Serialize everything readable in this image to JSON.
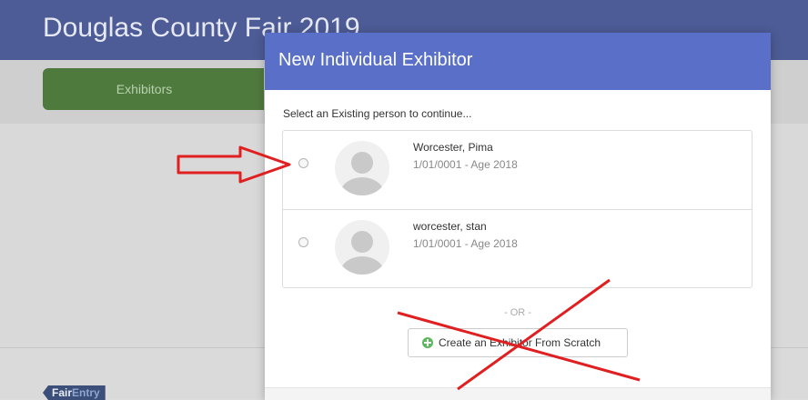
{
  "background": {
    "title": "Douglas County Fair 2019",
    "tab_label": "Exhibitors",
    "logo": "FairEntry"
  },
  "modal": {
    "title": "New Individual Exhibitor",
    "subtitle": "Select an Existing person to continue...",
    "people": [
      {
        "name": "Worcester, Pima",
        "meta": "1/01/0001 - Age 2018"
      },
      {
        "name": "worcester, stan",
        "meta": "1/01/0001 - Age 2018"
      }
    ],
    "or_text": "- OR -",
    "create_button": "Create an Exhibitor From Scratch",
    "create_icon": "plus-circle-icon"
  },
  "colors": {
    "header": "#4d5b96",
    "modal_header": "#5a70c8",
    "tab": "#4f7a3e",
    "annotation": "#e02020"
  }
}
